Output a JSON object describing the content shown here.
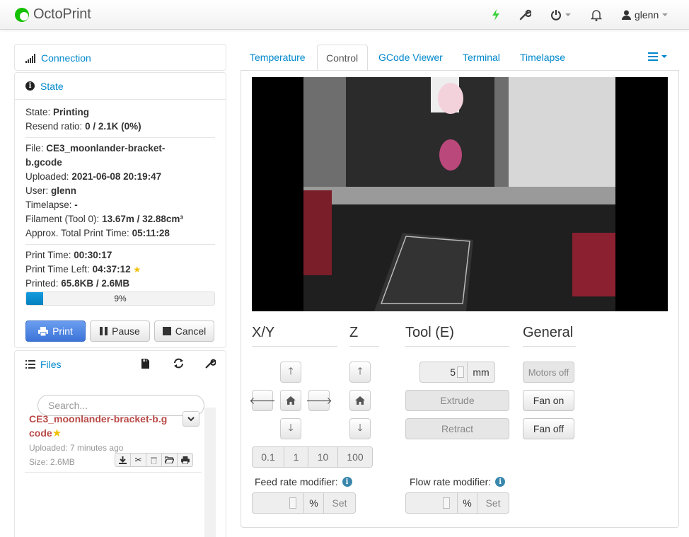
{
  "app": {
    "name": "OctoPrint"
  },
  "navbar": {
    "user": "glenn"
  },
  "sidebar": {
    "connection_title": "Connection",
    "state_title": "State",
    "state": {
      "state_label": "State:",
      "state_value": "Printing",
      "resend_label": "Resend ratio:",
      "resend_value": "0 / 2.1K (0%)",
      "file_label": "File:",
      "file_value_1": "CE3_moonlander-bracket-",
      "file_value_2": "b.gcode",
      "uploaded_label": "Uploaded:",
      "uploaded_value": "2021-06-08 20:19:47",
      "user_label": "User:",
      "user_value": "glenn",
      "timelapse_label": "Timelapse:",
      "timelapse_value": "-",
      "filament_label": "Filament (Tool 0):",
      "filament_value": "13.67m / 32.88cm³",
      "approx_label": "Approx. Total Print Time:",
      "approx_value": "05:11:28",
      "printtime_label": "Print Time:",
      "printtime_value": "00:30:17",
      "timeleft_label": "Print Time Left:",
      "timeleft_value": "04:37:12",
      "printed_label": "Printed:",
      "printed_value": "65.8KB / 2.6MB",
      "progress_text": "9%",
      "progress_fraction": 0.09
    },
    "buttons": {
      "print": "Print",
      "pause": "Pause",
      "cancel": "Cancel"
    },
    "files": {
      "title": "Files",
      "search_placeholder": "Search...",
      "item": {
        "name_1": "CE3_moonlander-bracket-b.g",
        "name_2": "code",
        "uploaded": "Uploaded: 7 minutes ago",
        "size": "Size: 2.6MB"
      }
    }
  },
  "tabs": [
    "Temperature",
    "Control",
    "GCode Viewer",
    "Terminal",
    "Timelapse"
  ],
  "control": {
    "xy_title": "X/Y",
    "z_title": "Z",
    "tool_title": "Tool (E)",
    "general_title": "General",
    "steps": [
      "0.1",
      "1",
      "10",
      "100"
    ],
    "extrude_amount": "5",
    "extrude_unit": "mm",
    "extrude_label": "Extrude",
    "retract_label": "Retract",
    "motors_off": "Motors off",
    "fan_on": "Fan on",
    "fan_off": "Fan off",
    "feed_rate_label": "Feed rate modifier:",
    "flow_rate_label": "Flow rate modifier:",
    "percent": "%",
    "set": "Set"
  },
  "colors": {
    "link": "#0088cc",
    "progress": "#149bdf",
    "primary": "#3c74d8",
    "file_name": "#b94a48"
  }
}
